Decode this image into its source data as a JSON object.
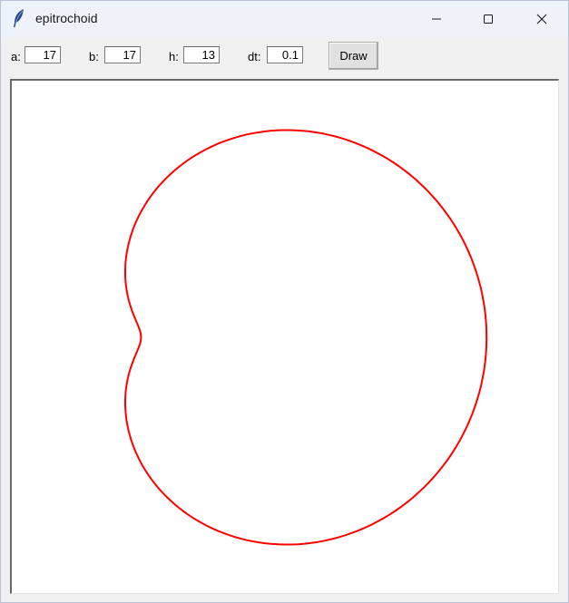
{
  "window": {
    "title": "epitrochoid",
    "app_icon": "feather-icon",
    "controls": [
      "minimize-icon",
      "maximize-icon",
      "close-icon"
    ]
  },
  "toolbar": {
    "fields": [
      {
        "label": "a:",
        "value": "17"
      },
      {
        "label": "b:",
        "value": "17"
      },
      {
        "label": "h:",
        "value": "13"
      },
      {
        "label": "dt:",
        "value": "0.1"
      }
    ],
    "draw_label": "Draw"
  },
  "canvas": {
    "background": "#ffffff",
    "curve": {
      "type": "epitrochoid",
      "a": 17,
      "b": 17,
      "h": 13,
      "dt": 0.1,
      "color": "#ff0000"
    }
  }
}
